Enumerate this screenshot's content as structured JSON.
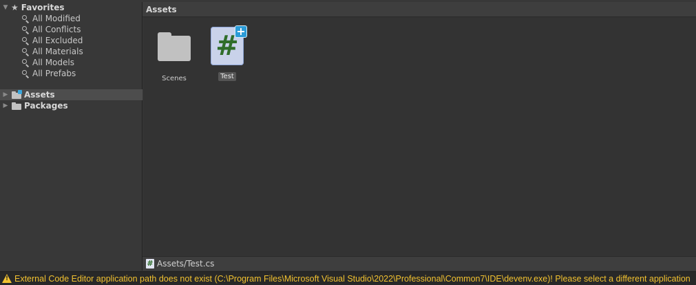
{
  "sidebar": {
    "favorites": {
      "label": "Favorites",
      "items": [
        {
          "label": "All Modified"
        },
        {
          "label": "All Conflicts"
        },
        {
          "label": "All Excluded"
        },
        {
          "label": "All Materials"
        },
        {
          "label": "All Models"
        },
        {
          "label": "All Prefabs"
        }
      ]
    },
    "roots": [
      {
        "label": "Assets",
        "selected": true
      },
      {
        "label": "Packages",
        "selected": false
      }
    ]
  },
  "content": {
    "header_title": "Assets",
    "assets": [
      {
        "name": "Scenes",
        "type": "folder",
        "icon": "folder-icon"
      },
      {
        "name": "Test",
        "type": "csharp-script",
        "icon": "csharp-script-icon",
        "selected": true
      }
    ],
    "script_glyph": "#",
    "new_badge_glyph": "+"
  },
  "path_bar": {
    "path": "Assets/Test.cs",
    "icon_glyph": "#"
  },
  "status_bar": {
    "message": "External Code Editor application path does not exist (C:\\Program Files\\Microsoft Visual Studio\\2022\\Professional\\Common7\\IDE\\devenv.exe)! Please select a different application",
    "warning_glyph": "!",
    "color": "#f2c230"
  },
  "colors": {
    "background": "#383838",
    "grid_background": "#333333",
    "selection": "#4d4d4d",
    "accent_badge": "#2b9bd7",
    "csharp_green": "#2f6d2a"
  }
}
